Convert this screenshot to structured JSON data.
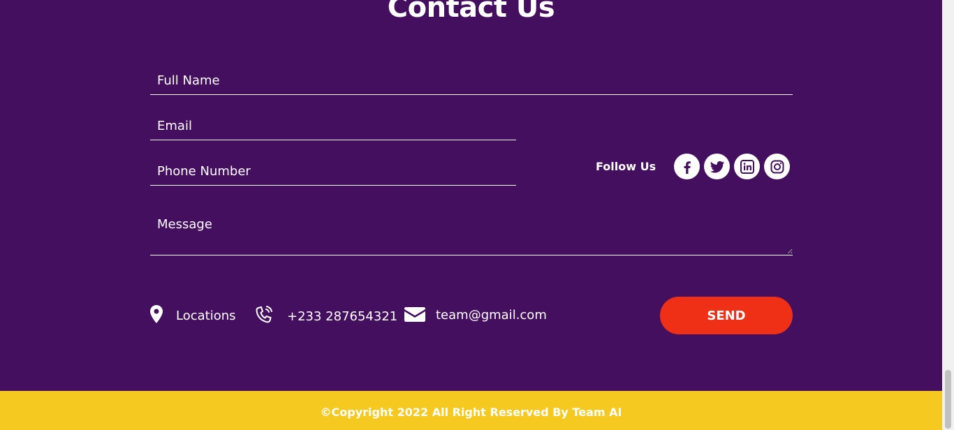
{
  "contact": {
    "title": "Contact Us",
    "fields": {
      "full_name_placeholder": "Full Name",
      "email_placeholder": "Email",
      "phone_placeholder": "Phone Number",
      "message_placeholder": "Message"
    },
    "follow_label": "Follow Us",
    "socials": [
      {
        "name": "facebook",
        "icon": "facebook-icon"
      },
      {
        "name": "twitter",
        "icon": "twitter-icon"
      },
      {
        "name": "linkedin",
        "icon": "linkedin-icon"
      },
      {
        "name": "instagram",
        "icon": "instagram-icon"
      }
    ],
    "info": {
      "location_label": "Locations",
      "location_icon": "map-pin-icon",
      "phone": "+233 287654321",
      "phone_icon": "phone-icon",
      "email": "team@gmail.com",
      "email_icon": "envelope-icon"
    },
    "send_label": "SEND"
  },
  "footer": {
    "copyright": "©Copyright 2022 All Right Reserved By Team AI"
  },
  "colors": {
    "background": "#440f5e",
    "accent_button": "#ef2f16",
    "footer": "#f5c91f",
    "text": "#ffffff"
  }
}
